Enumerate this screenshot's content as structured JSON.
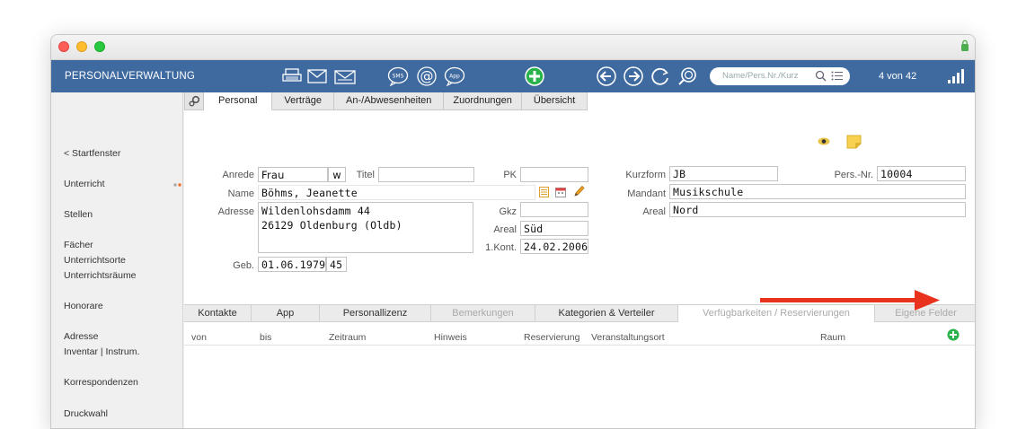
{
  "app": {
    "title": "PERSONALVERWALTUNG",
    "counter": "4 von 42",
    "search_placeholder": "Name/Pers.Nr./Kurz"
  },
  "toolbar": {
    "icons": [
      "printer-icon",
      "mail-icon",
      "mail-open-icon",
      "sms-icon",
      "at-icon",
      "app-icon",
      "add-icon",
      "back-icon",
      "forward-icon",
      "refresh-icon",
      "search-icon"
    ],
    "sms": "SMS",
    "at": "@",
    "app_label": "App"
  },
  "sidebar": {
    "items": [
      "< Startfenster",
      "Unterricht",
      "Stellen",
      "Fächer",
      "Unterrichtsorte",
      "Unterrichtsräume",
      "Honorare",
      "Adresse",
      "Inventar | Instrum.",
      "Korrespondenzen",
      "Druckwahl"
    ]
  },
  "tabs_top": [
    "Personal",
    "Verträge",
    "An-/Abwesenheiten",
    "Zuordnungen",
    "Übersicht"
  ],
  "form": {
    "anrede_label": "Anrede",
    "anrede": "Frau",
    "gender": "w",
    "titel_label": "Titel",
    "titel": "",
    "pk_label": "PK",
    "pk": "",
    "name_label": "Name",
    "name": "Böhms, Jeanette",
    "adresse_label": "Adresse",
    "adresse_line1": "Wildenlohsdamm 44",
    "adresse_line2": "26129 Oldenburg (Oldb)",
    "gkz_label": "Gkz",
    "gkz": "",
    "areal_label": "Areal",
    "areal": "Süd",
    "kont_label": "1.Kont.",
    "kont": "24.02.2006",
    "geb_label": "Geb.",
    "geb": "01.06.1979",
    "age": "45",
    "kurzform_label": "Kurzform",
    "kurzform": "JB",
    "persnr_label": "Pers.-Nr.",
    "persnr": "10004",
    "mandant_label": "Mandant",
    "mandant": "Musikschule",
    "areal2_label": "Areal",
    "areal2": "Nord"
  },
  "tabs_bottom": [
    "Kontakte",
    "App",
    "Personallizenz",
    "Bemerkungen",
    "Kategorien & Verteiler",
    "Verfügbarkeiten / Reservierungen",
    "Eigene Felder"
  ],
  "table": {
    "columns": [
      "von",
      "bis",
      "Zeitraum",
      "Hinweis",
      "Reservierung",
      "Veranstaltungsort",
      "Raum"
    ]
  },
  "colors": {
    "appbar": "#3f6aa0",
    "add": "#2ab34a",
    "arrow": "#e8321e"
  }
}
